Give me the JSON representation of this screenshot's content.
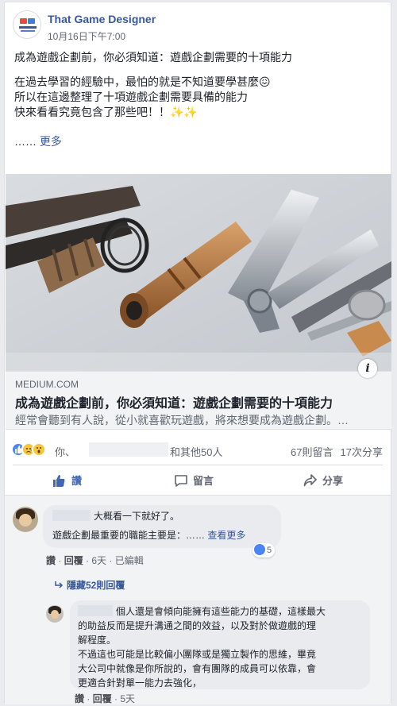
{
  "post": {
    "page_name": "That Game Designer",
    "timestamp": "10月16日下午7:00",
    "text_lines_1": [
      "成為遊戲企劃前，你必須知道：遊戲企劃需要的十項能力"
    ],
    "text_lines_2": [
      "在過去學習的經驗中，最怕的就是不知道要學甚麼😖",
      "所以在這邊整理了十項遊戲企劃需要具備的能力",
      "快來看看究竟包含了那些吧！！✨✨"
    ],
    "ellipsis": "……",
    "more_label": "更多"
  },
  "link_preview": {
    "domain": "MEDIUM.COM",
    "title": "成為遊戲企劃前，你必須知道：遊戲企劃需要的十項能力",
    "description": "經常會聽到有人說，從小就喜歡玩遊戲，將來想要成為遊戲企劃。…",
    "info_icon": "i"
  },
  "reactions": {
    "you": "你、",
    "others": "和其他50人",
    "comment_count": "67則留言",
    "share_count": "17次分享"
  },
  "actions": {
    "like": "讚",
    "comment": "留言",
    "share": "分享"
  },
  "comments": [
    {
      "text": "大概看一下就好了。",
      "subtext": "遊戲企劃最重要的職能主要是：……",
      "see_more": "查看更多",
      "like_count": "5",
      "meta_like": "讚",
      "meta_reply": "回覆",
      "meta_time": "6天",
      "meta_edited": "已編輯"
    }
  ],
  "hidden_replies": "隱藏52則回覆",
  "reply": {
    "lines": [
      "個人還是會傾向能擁有這些能力的基礎，這樣最大",
      "的助益反而是提升溝通之間的效益，以及對於做遊戲的理",
      "解程度。",
      "不過這也可能是比較偏小團隊或是獨立製作的思維，畢竟",
      "大公司中就像是你所說的，會有團隊的成員可以依靠，會",
      "更適合針對單一能力去強化，"
    ],
    "meta_like": "讚",
    "meta_reply": "回覆",
    "meta_time": "5天"
  }
}
